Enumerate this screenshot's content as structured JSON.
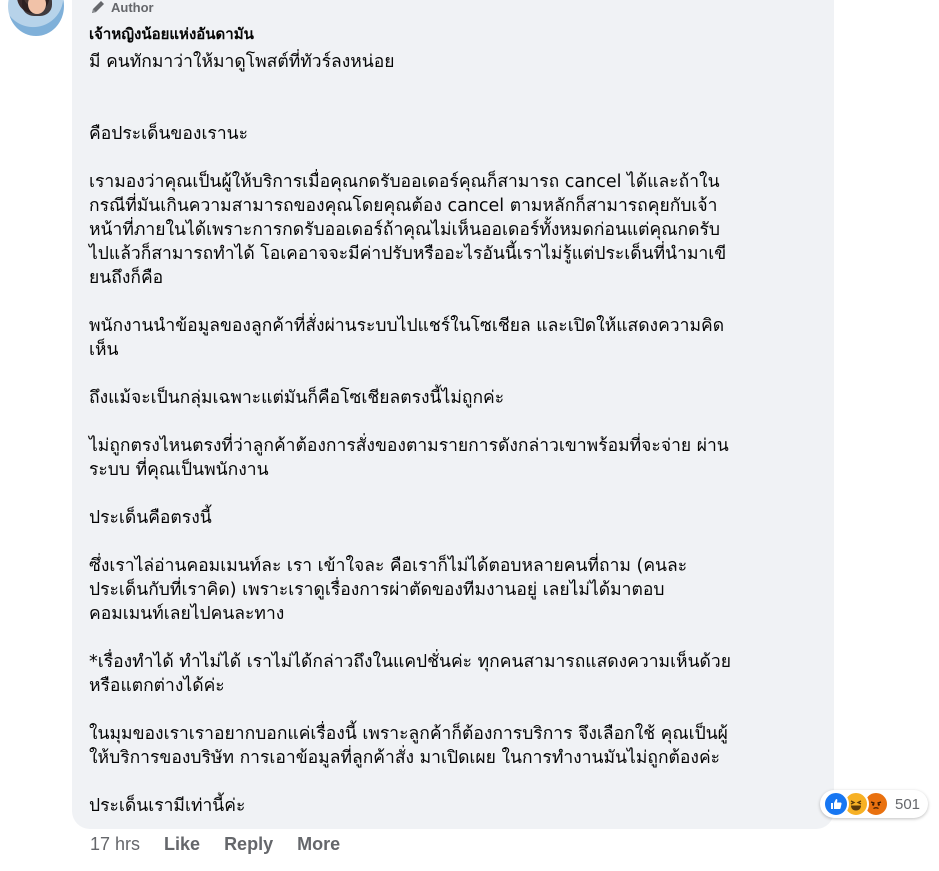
{
  "comment": {
    "author_badge": "Author",
    "author_name": "เจ้าหญิงน้อยแห่งอันดามัน",
    "text": "มี คนทักมาว่าให้มาดูโพสต์ที่ทัวร์ลงหน่อย\n\n\nคือประเด็นของเรานะ\n\nเรามองว่าคุณเป็นผู้ให้บริการเมื่อคุณกดรับออเดอร์คุณก็สามารถ cancel ได้และถ้าใน\nกรณีที่มันเกินความสามารถของคุณโดยคุณต้อง cancel ตามหลักก็สามารถคุยกับเจ้า\nหน้าที่ภายในได้เพราะการกดรับออเดอร์ถ้าคุณไม่เห็นออเดอร์ทั้งหมดก่อนแต่คุณกดรับ\nไปแล้วก็สามารถทำได้ โอเคอาจจะมีค่าปรับหรืออะไรอันนี้เราไม่รู้แต่ประเด็นที่นำมาเขี\nยนถึงก็คือ\n\nพนักงานนำข้อมูลของลูกค้าที่สั่งผ่านระบบไปแชร์ในโซเชียล และเปิดให้แสดงความคิด\nเห็น\n\nถึงแม้จะเป็นกลุ่มเฉพาะแต่มันก็คือโซเชียลตรงนี้ไม่ถูกค่ะ\n\nไม่ถูกตรงไหนตรงที่ว่าลูกค้าต้องการสั่งของตามรายการดังกล่าวเขาพร้อมที่จะจ่าย ผ่าน\nระบบ ที่คุณเป็นพนักงาน\n\nประเด็นคือตรงนี้\n\nซึ่งเราไล่อ่านคอมเมนท์ละ เรา เข้าใจละ คือเราก็ไม่ได้ตอบหลายคนที่ถาม (คนละ\nประเด็นกับที่เราคิด) เพราะเราดูเรื่องการผ่าตัดของทีมงานอยู่ เลยไม่ได้มาตอบ\nคอมเมนท์เลยไปคนละทาง\n\n*เรื่องทำได้ ทำไม่ได้ เราไม่ได้กล่าวถึงในแคปชั่นค่ะ ทุกคนสามารถแสดงความเห็นด้วย\nหรือแตกต่างได้ค่ะ\n\nในมุมของเราเราอยากบอกแค่เรื่องนี้ เพราะลูกค้าก็ต้องการบริการ จึงเลือกใช้ คุณเป็นผู้\nให้บริการของบริษัท การเอาข้อมูลที่ลูกค้าสั่ง มาเปิดเผย ในการทำงานมันไม่ถูกต้องค่ะ\n\nประเด็นเรามีเท่านี้ค่ะ"
  },
  "reactions": {
    "count": "501",
    "types": [
      "like-icon",
      "haha-icon",
      "angry-icon"
    ]
  },
  "actions": {
    "timestamp": "17 hrs",
    "like": "Like",
    "reply": "Reply",
    "more": "More"
  },
  "colors": {
    "bubble": "#f0f2f5",
    "secondary_text": "#65676b",
    "like_blue": "#1877f2"
  }
}
